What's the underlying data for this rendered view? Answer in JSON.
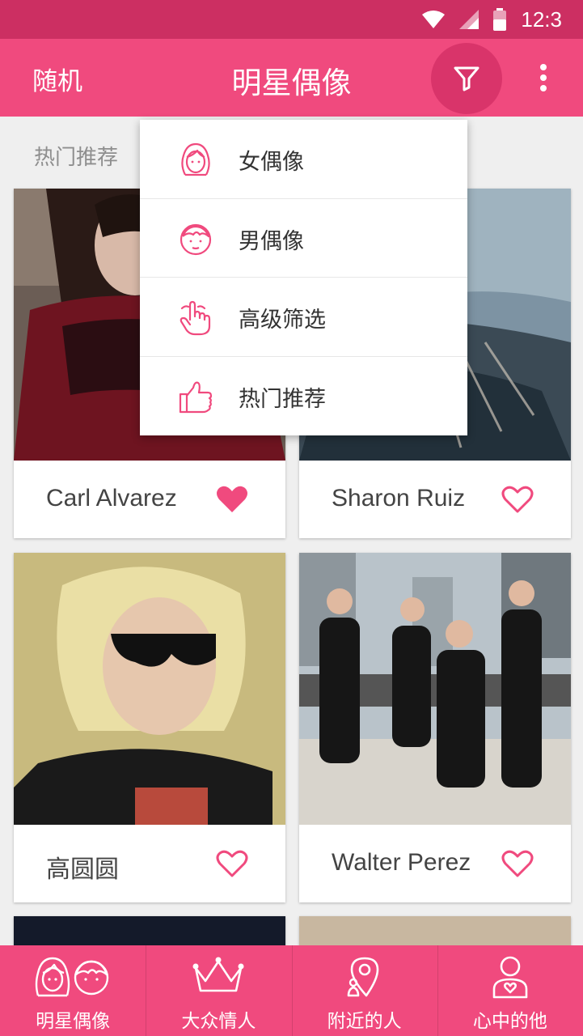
{
  "status_bar": {
    "time": "12:3"
  },
  "app_bar": {
    "left_action": "随机",
    "title": "明星偶像"
  },
  "section": {
    "title": "热门推荐"
  },
  "filter_menu": {
    "items": [
      {
        "label": "女偶像",
        "icon": "female-face-icon"
      },
      {
        "label": "男偶像",
        "icon": "male-face-icon"
      },
      {
        "label": "高级筛选",
        "icon": "finger-tap-icon"
      },
      {
        "label": "热门推荐",
        "icon": "thumbs-up-icon"
      }
    ]
  },
  "cards": [
    {
      "name": "Carl Alvarez",
      "liked": true
    },
    {
      "name": "Sharon Ruiz",
      "liked": false
    },
    {
      "name": "高圆圆",
      "liked": false
    },
    {
      "name": "Walter Perez",
      "liked": false
    }
  ],
  "bottom_nav": {
    "items": [
      {
        "label": "明星偶像",
        "icon": "idols-icon"
      },
      {
        "label": "大众情人",
        "icon": "crown-icon"
      },
      {
        "label": "附近的人",
        "icon": "location-pin-icon"
      },
      {
        "label": "心中的他",
        "icon": "person-heart-icon"
      }
    ]
  },
  "colors": {
    "primary": "#f04a7e",
    "primary_dark": "#cc2f62",
    "accent": "#f04a7e"
  }
}
